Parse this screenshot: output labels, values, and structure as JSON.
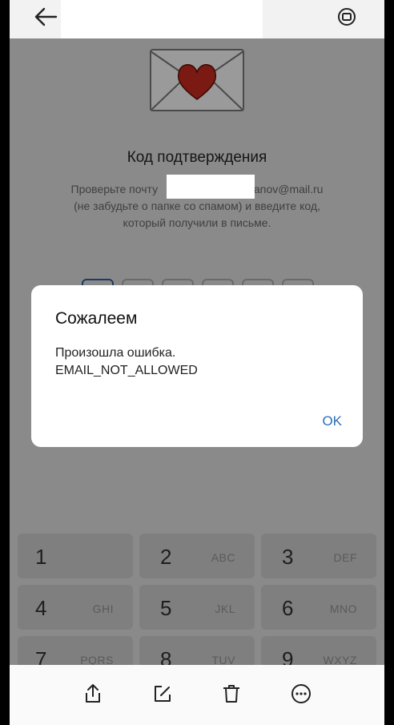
{
  "screen": {
    "title": "Код подтверждения",
    "description_line1_before": "Проверьте почту",
    "description_line1_after": "anov@mail.ru",
    "description_line2": "(не забудьте о папке со спамом) и введите код,",
    "description_line3": "который получили в письме.",
    "code_boxes": 6
  },
  "dialog": {
    "title": "Сожалеем",
    "message_line1": "Произошла ошибка.",
    "message_line2": "EMAIL_NOT_ALLOWED",
    "ok_label": "OK"
  },
  "keypad": {
    "keys": [
      {
        "digit": "1",
        "letters": ""
      },
      {
        "digit": "2",
        "letters": "ABC"
      },
      {
        "digit": "3",
        "letters": "DEF"
      },
      {
        "digit": "4",
        "letters": "GHI"
      },
      {
        "digit": "5",
        "letters": "JKL"
      },
      {
        "digit": "6",
        "letters": "MNO"
      },
      {
        "digit": "7",
        "letters": "PQRS"
      },
      {
        "digit": "8",
        "letters": "TUV"
      },
      {
        "digit": "9",
        "letters": "WXYZ"
      }
    ]
  },
  "icons": {
    "back": "back-arrow-icon",
    "rotate": "rotate-screen-icon",
    "envelope": "envelope-heart-icon",
    "share": "share-icon",
    "edit": "edit-icon",
    "delete": "trash-icon",
    "more": "more-icon"
  }
}
